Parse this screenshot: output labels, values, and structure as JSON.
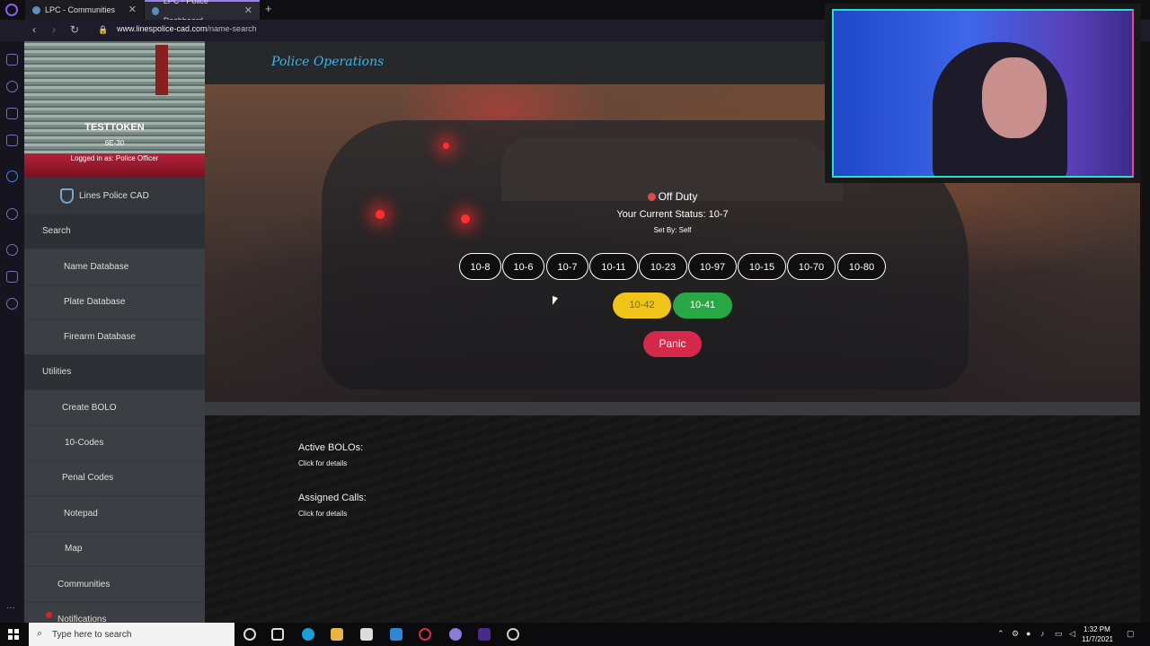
{
  "browser": {
    "tabs": [
      {
        "title": "LPC - Communities"
      },
      {
        "title": "LPC - Police Dashboard"
      }
    ],
    "new_tab": "+",
    "url_domain": "www.linespolice-cad.com",
    "url_path": "/name-search"
  },
  "sidebar": {
    "user": {
      "name": "TESTTOKEN",
      "callsign": "6E-30",
      "role_line": "Logged in as: Police Officer"
    },
    "brand": "Lines Police CAD",
    "items": [
      {
        "label": "Search",
        "section": true
      },
      {
        "label": "Name Database"
      },
      {
        "label": "Plate Database"
      },
      {
        "label": "Firearm Database"
      },
      {
        "label": "Utilities",
        "section": true
      },
      {
        "label": "Create BOLO"
      },
      {
        "label": "10-Codes"
      },
      {
        "label": "Penal Codes"
      },
      {
        "label": "Notepad"
      },
      {
        "label": "Map"
      },
      {
        "label": "Communities"
      },
      {
        "label": "Notifications"
      }
    ]
  },
  "header": {
    "title": "Police Operations"
  },
  "status": {
    "duty": "Off Duty",
    "current": "Your Current Status: 10-7",
    "set_by": "Set By: Self",
    "duty_color": "#e04848"
  },
  "codes": [
    "10-8",
    "10-6",
    "10-7",
    "10-11",
    "10-23",
    "10-97",
    "10-15",
    "10-70",
    "10-80"
  ],
  "actions": {
    "code_1042": "10-42",
    "code_1041": "10-41",
    "panic": "Panic"
  },
  "lower": {
    "bolos_title": "Active BOLOs:",
    "bolos_sub": "Click for details",
    "calls_title": "Assigned Calls:",
    "calls_sub": "Click for details"
  },
  "taskbar": {
    "search_placeholder": "Type here to search",
    "time": "1:32 PM",
    "date": "11/7/2021"
  },
  "colors": {
    "accent": "#3fb5e8",
    "yellow": "#f0c419",
    "green": "#28a745",
    "panic": "#d6284a"
  }
}
